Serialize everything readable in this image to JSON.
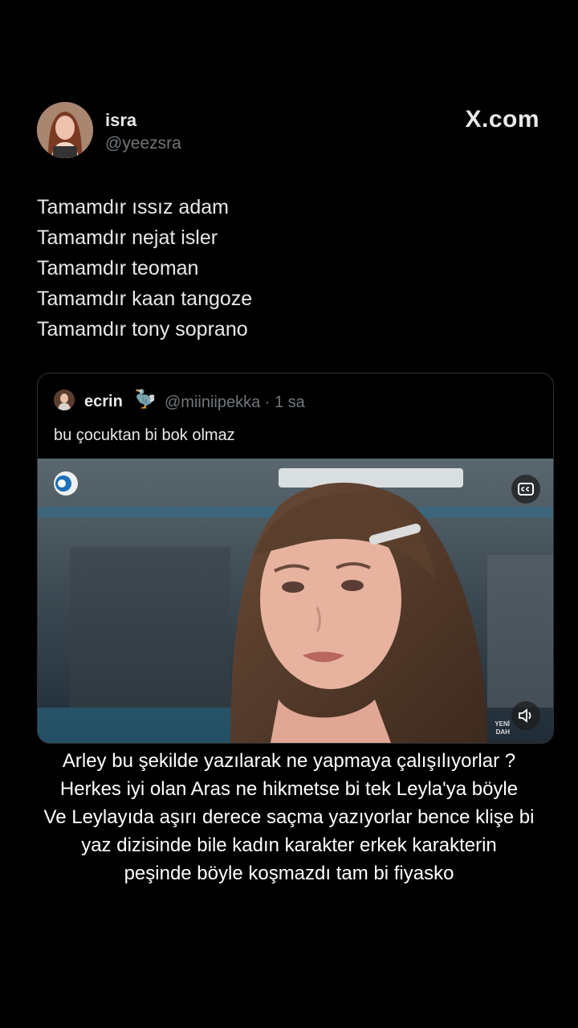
{
  "author": {
    "name": "isra",
    "handle": "@yeezsra",
    "avatar_icon": "profile-photo-icon"
  },
  "site": {
    "logo_text": "X.com"
  },
  "tweet": {
    "lines": [
      "Tamamdır ıssız adam",
      "Tamamdır nejat isler",
      "Tamamdır teoman",
      "Tamamdır kaan tangoze",
      "Tamamdır tony soprano"
    ]
  },
  "quote": {
    "name": "ecrin",
    "emoji": "🦤",
    "meta": "@miiniipekka · 1 sa",
    "text": "bu çocuktan bi bok olmaz",
    "video": {
      "channel_icon": "channel-logo-icon",
      "cc_icon": "closed-captions-icon",
      "mute_icon": "speaker-icon",
      "watermark_line1": "YENİ",
      "watermark_line2": "DAH"
    }
  },
  "caption": {
    "lines": [
      "Arley bu şekilde yazılarak ne yapmaya  çalışılıyorlar  ?",
      "Herkes iyi olan Aras ne hikmetse bi tek Leyla'ya böyle",
      "Ve Leylayıda aşırı derece saçma yazıyorlar bence klişe bi",
      "yaz dizisinde bile kadın karakter erkek karakterin",
      "peşinde böyle koşmazdı tam bi fiyasko"
    ]
  },
  "colors": {
    "background": "#000000",
    "text": "#e7e9ea",
    "secondary": "#71767b",
    "border": "#2f3336"
  }
}
